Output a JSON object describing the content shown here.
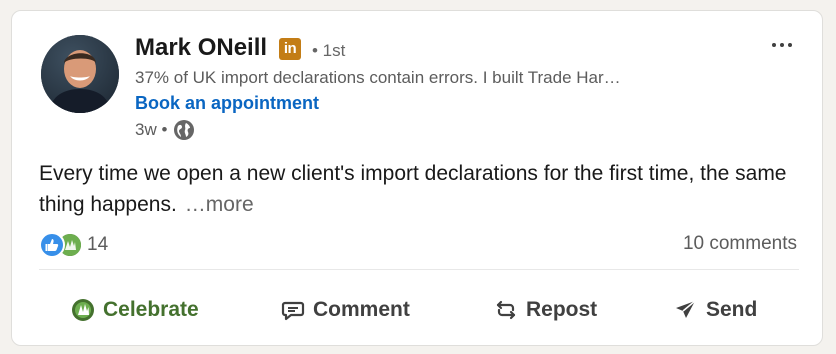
{
  "post": {
    "author_name": "Mark ONeill",
    "badge_text": "in",
    "degree": "• 1st",
    "headline": "37% of UK import declarations contain errors. I built Trade Har…",
    "cta_link": "Book an appointment",
    "time_ago": "3w •",
    "body": "Every time we open a new client's import declarations for the first time, the same thing happens.",
    "see_more": "…more"
  },
  "social": {
    "reaction_count": "14",
    "comments": "10 comments"
  },
  "actions": {
    "celebrate": "Celebrate",
    "comment": "Comment",
    "repost": "Repost",
    "send": "Send"
  },
  "colors": {
    "link_blue": "#0a66c2",
    "celebrate_green": "#44712e",
    "premium_gold": "#c37d16",
    "like_blue": "#378fe9"
  },
  "icons": {
    "visibility": "globe-icon",
    "menu": "more-horizontal-icon",
    "celebrate": "celebrate-icon",
    "comment": "comment-icon",
    "repost": "repost-icon",
    "send": "send-icon"
  }
}
